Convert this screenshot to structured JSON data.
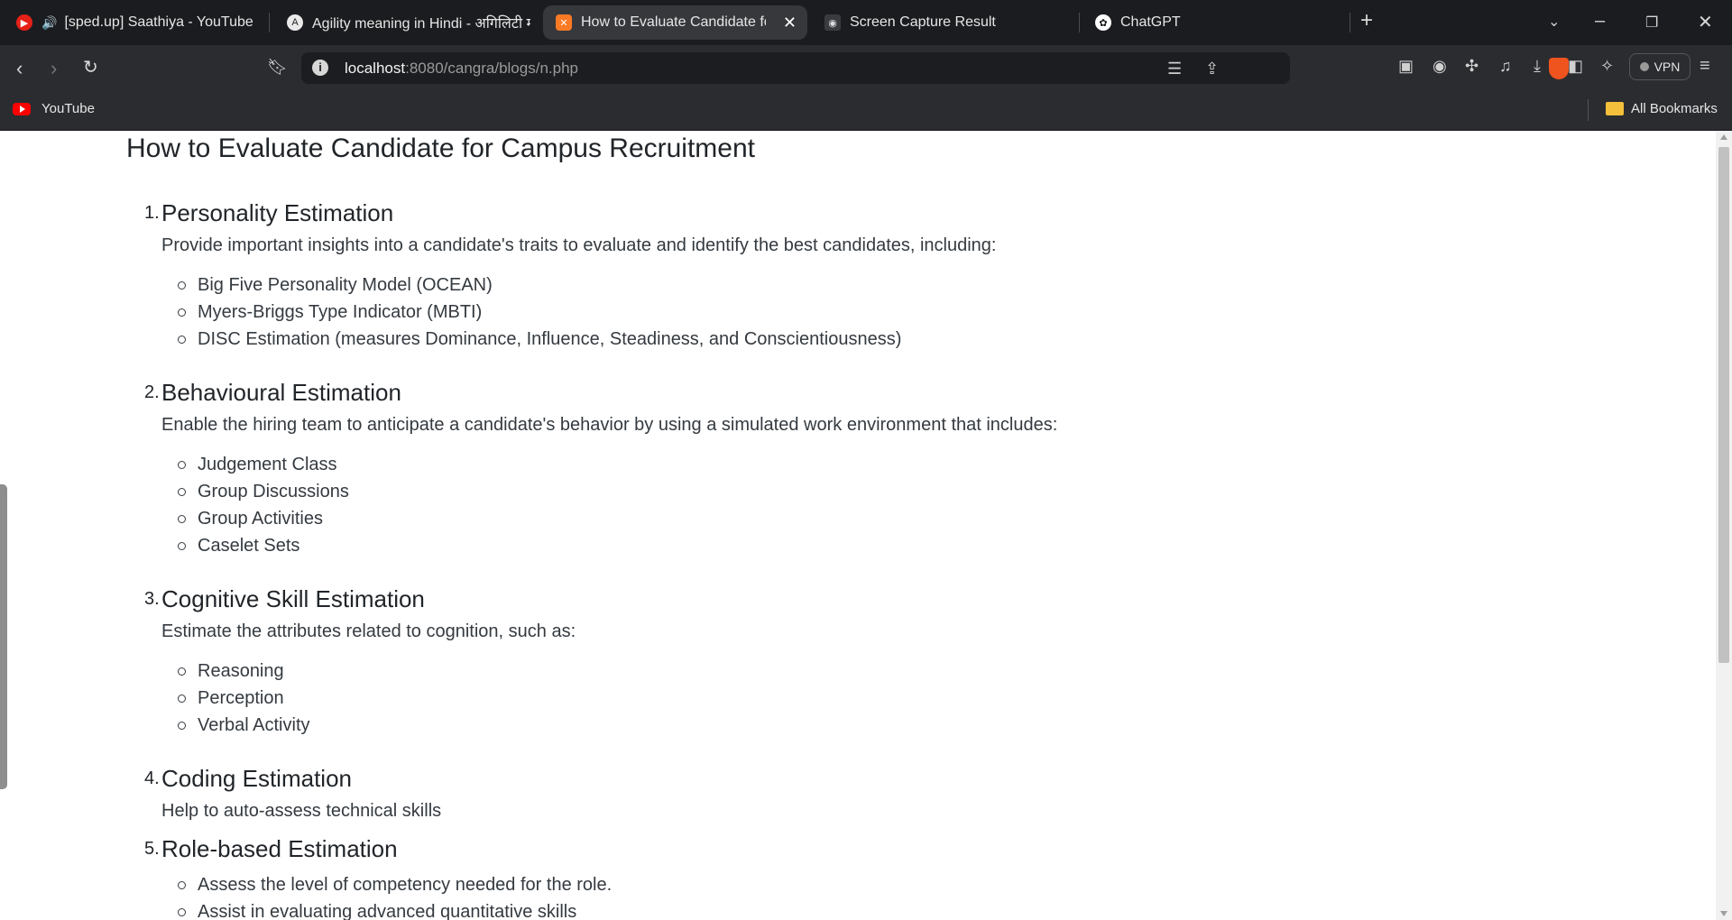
{
  "browser": {
    "tabs": [
      {
        "title": "[sped.up] Saathiya - YouTube Mu",
        "icon": "youtube-icon",
        "audio": true,
        "active": false
      },
      {
        "title": "Agility meaning in Hindi - अगिलिटी म",
        "icon": "dictionary-icon",
        "active": false
      },
      {
        "title": "How to Evaluate Candidate for C",
        "icon": "xampp-icon",
        "active": true
      },
      {
        "title": "Screen Capture Result",
        "icon": "camera-icon",
        "active": false
      },
      {
        "title": "ChatGPT",
        "icon": "chatgpt-icon",
        "active": false
      }
    ],
    "url_host": "localhost",
    "url_rest": ":8080/cangra/blogs/n.php",
    "vpn_label": "VPN",
    "bookmarks": [
      {
        "label": "YouTube",
        "icon": "youtube-icon"
      }
    ],
    "all_bookmarks_label": "All Bookmarks"
  },
  "page": {
    "title": "How to Evaluate Candidate for Campus Recruitment",
    "sections": [
      {
        "number": "1.",
        "heading": "Personality Estimation",
        "description": "Provide important insights into a candidate's traits to evaluate and identify the best candidates, including:",
        "items": [
          "Big Five Personality Model (OCEAN)",
          "Myers-Briggs Type Indicator (MBTI)",
          "DISC Estimation (measures Dominance, Influence, Steadiness, and Conscientiousness)"
        ]
      },
      {
        "number": "2.",
        "heading": "Behavioural Estimation",
        "description": "Enable the hiring team to anticipate a candidate's behavior by using a simulated work environment that includes:",
        "items": [
          "Judgement Class",
          "Group Discussions",
          "Group Activities",
          "Caselet Sets"
        ]
      },
      {
        "number": "3.",
        "heading": "Cognitive Skill Estimation",
        "description": "Estimate the attributes related to cognition, such as:",
        "items": [
          "Reasoning",
          "Perception",
          "Verbal Activity"
        ]
      },
      {
        "number": "4.",
        "heading": "Coding Estimation",
        "description": "Help to auto-assess technical skills",
        "items": []
      },
      {
        "number": "5.",
        "heading": "Role-based Estimation",
        "description": "",
        "items": [
          "Assess the level of competency needed for the role.",
          "Assist in evaluating advanced quantitative skills"
        ]
      }
    ]
  }
}
